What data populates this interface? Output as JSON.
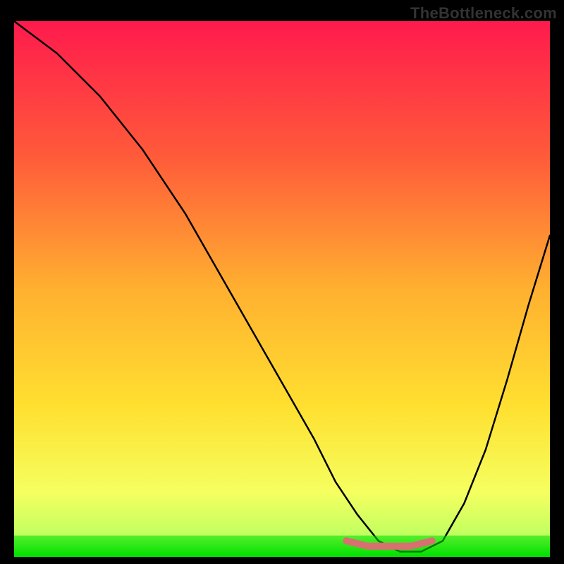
{
  "watermark": "TheBottleneck.com",
  "chart_data": {
    "type": "line",
    "title": "",
    "xlabel": "",
    "ylabel": "",
    "xlim": [
      0,
      100
    ],
    "ylim": [
      0,
      100
    ],
    "grid": false,
    "legend": false,
    "series": [
      {
        "name": "black-curve",
        "color": "#000000",
        "x": [
          0,
          8,
          16,
          24,
          32,
          40,
          48,
          56,
          60,
          64,
          68,
          72,
          76,
          80,
          84,
          88,
          92,
          96,
          100
        ],
        "values": [
          100,
          94,
          86,
          76,
          64,
          50,
          36,
          22,
          14,
          8,
          3,
          1,
          1,
          3,
          10,
          20,
          33,
          47,
          60
        ]
      },
      {
        "name": "green-band",
        "color": "#00e000",
        "x": [
          0,
          100
        ],
        "values": [
          2,
          2
        ]
      },
      {
        "name": "floor-highlight",
        "color": "#d87070",
        "x": [
          62,
          66,
          70,
          74,
          78
        ],
        "values": [
          3,
          2,
          2,
          2,
          3
        ]
      }
    ],
    "background_gradient": {
      "type": "linear-vertical",
      "stops": [
        {
          "offset": 0.0,
          "color": "#ff1a4d"
        },
        {
          "offset": 0.25,
          "color": "#ff5a3a"
        },
        {
          "offset": 0.5,
          "color": "#ffb030"
        },
        {
          "offset": 0.72,
          "color": "#ffe030"
        },
        {
          "offset": 0.88,
          "color": "#f5ff60"
        },
        {
          "offset": 0.96,
          "color": "#c0ff60"
        },
        {
          "offset": 1.0,
          "color": "#00e000"
        }
      ]
    }
  }
}
